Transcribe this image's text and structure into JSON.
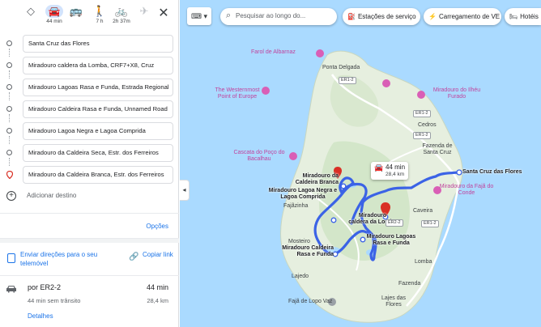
{
  "travel_modes": [
    {
      "name": "best",
      "icon": "diamond-directions-icon",
      "time": ""
    },
    {
      "name": "car",
      "icon": "car-icon",
      "time": "44 min"
    },
    {
      "name": "transit",
      "icon": "bus-icon",
      "time": ""
    },
    {
      "name": "walk",
      "icon": "walk-icon",
      "time": "7 h"
    },
    {
      "name": "bike",
      "icon": "bike-icon",
      "time": "2h 37m"
    },
    {
      "name": "flight",
      "icon": "plane-icon",
      "time": ""
    }
  ],
  "stops": [
    "Santa Cruz das Flores",
    "Miradouro caldera da Lomba, CRF7+X8, Cruz",
    "Miradouro Lagoas Rasa e Funda, Estrada Regional",
    "Miradouro Caldeira Rasa e Funda, Unnamed Road",
    "Miradouro Lagoa Negra e Lagoa Comprida",
    "Miradouro da Caldeira Seca, Estr. dos Ferreiros",
    "Miradouro da Caldeira Branca, Estr. dos Ferreiros"
  ],
  "add_destination": "Adicionar destino",
  "options_label": "Opções",
  "send_directions": "Enviar direções para o seu telemóvel",
  "copy_link": "Copiar link",
  "route": {
    "via": "por ER2-2",
    "time": "44 min",
    "traffic": "44 min sem trânsito",
    "distance": "28,4 km",
    "details": "Detalhes"
  },
  "map": {
    "search_placeholder": "Pesquisar ao longo do...",
    "chips": [
      "Estações de serviço",
      "Carregamento de VE",
      "Hotéis"
    ],
    "route_box": {
      "time": "44 min",
      "distance": "28,4 km"
    },
    "labels": {
      "farol": "Farol de Albarnaz",
      "ponta_delgada": "Ponta Delgada",
      "westernmost": "The Westernmost Point of Europe",
      "ilheu": "Miradouro do Ilhéu Furado",
      "cedros": "Cedros",
      "fazenda_sc": "Fazenda de Santa Cruz",
      "cascata": "Cascata do Poço do Bacalhau",
      "santa_cruz": "Santa Cruz das Flores",
      "faja_conde": "Miradouro da Fajã do Conde",
      "faja_grande": "Fajãzinha",
      "caldeira_branca": "Miradouro da Caldeira Branca",
      "lagoa_negra": "Miradouro Lagoa Negra e Lagoa Comprida",
      "lomba": "Miradouro caldera da Lomba",
      "lagoas": "Miradouro Lagoas Rasa e Funda",
      "caldeira_rasa": "Miradouro Caldeira Rasa e Funda",
      "caveira": "Caveira",
      "mosteiro": "Mosteiro",
      "lomba_town": "Lomba",
      "lajedo": "Lajedo",
      "fazenda": "Fazenda",
      "faja_lopo": "Fajã de Lopo Vaz",
      "lajes": "Lajes das Flores"
    },
    "road_tags": [
      "ER1-2",
      "ER1-2",
      "ER1-2",
      "ER1-2",
      "ER2-2"
    ],
    "colors": {
      "route": "#3b63e6",
      "land": "#e8f1e2",
      "water": "#aadaff",
      "pin": "#d93025"
    }
  }
}
